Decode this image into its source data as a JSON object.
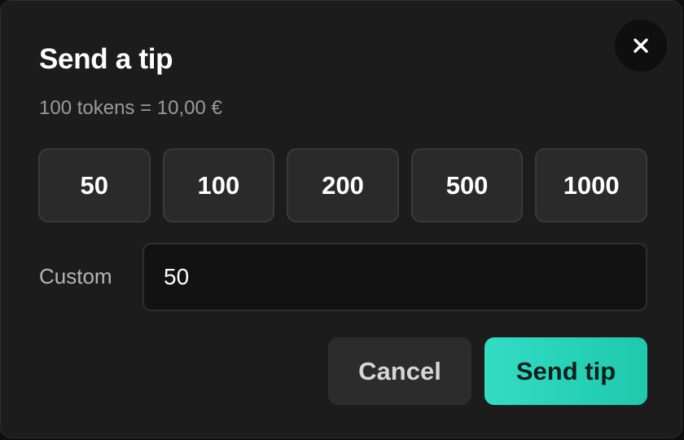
{
  "dialog": {
    "title": "Send a tip",
    "rate_text": "100 tokens = 10,00 €",
    "close_icon": "close-icon"
  },
  "amounts": [
    "50",
    "100",
    "200",
    "500",
    "1000"
  ],
  "custom": {
    "label": "Custom",
    "value": "50"
  },
  "actions": {
    "cancel_label": "Cancel",
    "send_label": "Send tip"
  },
  "colors": {
    "accent": "#26d0b5",
    "background": "#1c1c1c",
    "button": "#2a2a2a"
  }
}
